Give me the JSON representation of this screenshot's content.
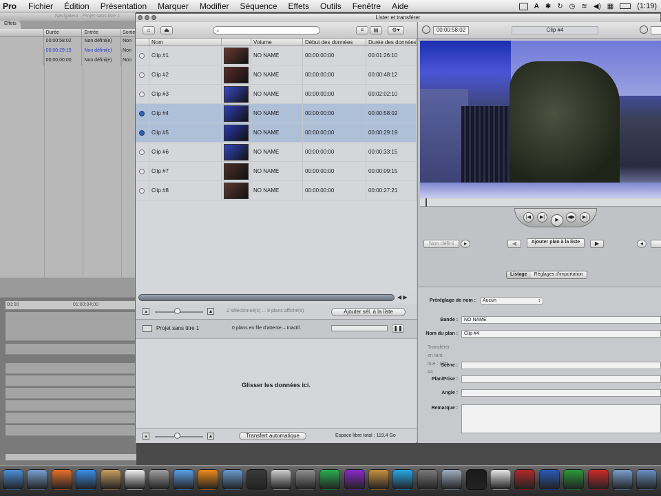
{
  "menubar": {
    "app": "Pro",
    "items": [
      "Fichier",
      "Édition",
      "Présentation",
      "Marquer",
      "Modifier",
      "Séquence",
      "Effets",
      "Outils",
      "Fenêtre",
      "Aide"
    ],
    "clock": "(1:19)"
  },
  "browser": {
    "title": "Navigateur : Projet sans titre 1",
    "tab": "Effets",
    "columns": [
      "Durée",
      "Entrée",
      "Sortie"
    ],
    "rows": [
      {
        "duree": "00:00:58:02",
        "entree": "Non défini(e)",
        "sortie": "Non"
      },
      {
        "duree": "00:00:29:19",
        "entree": "Non défini(e)",
        "sortie": "Non"
      },
      {
        "duree": "00:00:00:00",
        "entree": "Non défini(e)",
        "sortie": "Non"
      }
    ]
  },
  "timeline": {
    "start": "00:00",
    "mark": "01:00:04:00"
  },
  "window": {
    "title": "Lister et transférer",
    "columns": [
      "Nom",
      "Volume",
      "Début des données",
      "Durée des données"
    ],
    "clips": [
      {
        "name": "Clip #1",
        "volume": "NO NAME",
        "start": "00:00:00:00",
        "duration": "00:01:26:10",
        "selected": false,
        "thumb": "#6a3a30"
      },
      {
        "name": "Clip #2",
        "volume": "NO NAME",
        "start": "00:00:00:00",
        "duration": "00:00:48:12",
        "selected": false,
        "thumb": "#5a2c28"
      },
      {
        "name": "Clip #3",
        "volume": "NO NAME",
        "start": "00:00:00:00",
        "duration": "00:02:02:10",
        "selected": false,
        "thumb": "#3a4cc8"
      },
      {
        "name": "Clip #4",
        "volume": "NO NAME",
        "start": "00:00:00:00",
        "duration": "00:00:58:02",
        "selected": true,
        "thumb": "#3040b8"
      },
      {
        "name": "Clip #5",
        "volume": "NO NAME",
        "start": "00:00:00:00",
        "duration": "00:00:29:19",
        "selected": true,
        "thumb": "#2838b0"
      },
      {
        "name": "Clip #6",
        "volume": "NO NAME",
        "start": "00:00:00:00",
        "duration": "00:00:33:15",
        "selected": false,
        "thumb": "#3448c0"
      },
      {
        "name": "Clip #7",
        "volume": "NO NAME",
        "start": "00:00:00:00",
        "duration": "00:00:09:15",
        "selected": false,
        "thumb": "#4a3028"
      },
      {
        "name": "Clip #8",
        "volume": "NO NAME",
        "start": "00:00:00:00",
        "duration": "00:00:27:21",
        "selected": false,
        "thumb": "#5a3a30"
      }
    ],
    "selection_info": "2 sélectionné(s) ... 8 plans affiché(s)",
    "add_selection_button": "Ajouter sél. à la liste",
    "project_name": "Projet sans titre 1",
    "queue_status": "0 plans en file d'attente – Inactif.",
    "drop_message": "Glisser les données ici.",
    "auto_transfer_button": "Transfert automatique",
    "free_space": "Espace libre total : 119,4 Go"
  },
  "viewer": {
    "timecode": "00:00:58:02",
    "clip_name": "Clip #4",
    "not_defined": "Non défini",
    "add_clip_button": "Ajouter plan à la liste",
    "tabs": [
      "Listage",
      "Réglages d'importation"
    ]
  },
  "logging": {
    "preset_label": "Préréglage de nom :",
    "preset_value": "Aucun",
    "bande_label": "Bande :",
    "bande_value": "NO NAME",
    "clip_name_label": "Nom du plan :",
    "clip_name_value": "Clip #4",
    "transfer_as": "Transférer en tant que : Clip #4",
    "scene_label": "Scène :",
    "plan_label": "Plan/Prise :",
    "angle_label": "Angle :",
    "remark_label": "Remarque :"
  },
  "dock": {
    "icons": [
      "finder-icon",
      "preview-icon",
      "firefox-icon",
      "safari-icon",
      "notes-icon",
      "calendar-icon",
      "photo-icon",
      "itunes-icon",
      "vlc-icon",
      "iphoto-icon",
      "imovie-icon",
      "clapper-icon",
      "system-prefs-icon",
      "spotify-icon",
      "purple-app-icon",
      "package-icon",
      "skype-icon",
      "upload-icon",
      "camera-icon",
      "finalcut-icon",
      "textedit-icon",
      "photobooth-icon",
      "word-icon",
      "excel-icon",
      "magnet-icon",
      "folder-icon",
      "downloads-icon"
    ],
    "colors": [
      "#4a8fd8",
      "#7aa0d0",
      "#e8702a",
      "#3a8ee8",
      "#c8a060",
      "#f0f0f0",
      "#a0a0a0",
      "#5aa0e8",
      "#f08a1a",
      "#6a9ad0",
      "#3a3a3a",
      "#d0d0d0",
      "#909090",
      "#2ab050",
      "#8a2ac8",
      "#c89040",
      "#28a8e8",
      "#7a7a7a",
      "#a0b0c0",
      "#1a1a1a",
      "#e8e8e8",
      "#b02a2a",
      "#2a5ab8",
      "#2a9a3a",
      "#d02a2a",
      "#7aa0d0",
      "#6a90c0"
    ]
  }
}
